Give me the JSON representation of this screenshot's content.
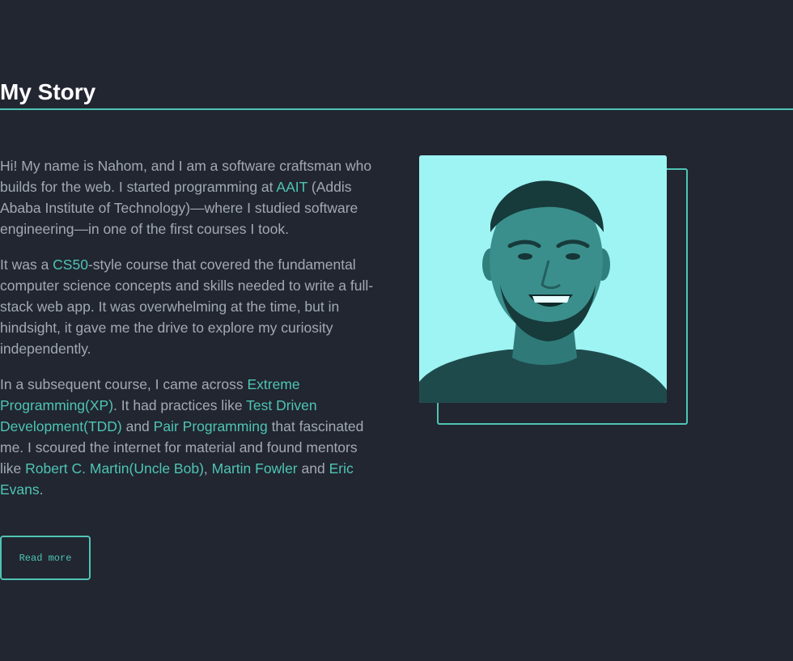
{
  "section": {
    "title": "My Story"
  },
  "story": {
    "p1": {
      "t1": "Hi! My name is Nahom, and I am a software craftsman who builds for the web. I started programming at ",
      "link_aait": "AAIT",
      "t2": " (Addis Ababa Institute of Technology)—where I studied software engineering—in one of the first courses I took."
    },
    "p2": {
      "t1": "It was a ",
      "link_cs50": "CS50",
      "t2": "-style course that covered the fundamental computer science concepts and skills needed to write a full-stack web app. It was overwhelming at the time, but in hindsight, it gave me the drive to explore my curiosity independently."
    },
    "p3": {
      "t1": "In a subsequent course, I came across ",
      "link_xp": "Extreme Programming(XP)",
      "t2": ". It had practices like ",
      "link_tdd": "Test Driven Development(TDD)",
      "t3": " and ",
      "link_pair": "Pair Programming",
      "t4": " that fascinated me. I scoured the internet for material and found mentors like ",
      "link_bob": "Robert C. Martin(Uncle Bob)",
      "t5": ", ",
      "link_fowler": "Martin Fowler",
      "t6": " and ",
      "link_evans": "Eric Evans",
      "t7": "."
    }
  },
  "read_more": {
    "label": "Read more"
  },
  "photo": {
    "alt": "portrait-photo"
  },
  "colors": {
    "background": "#212631",
    "accent": "#4fc4b4",
    "text": "#a3a9b3",
    "heading": "#ffffff",
    "photo_tint": "#9ef3f3"
  }
}
